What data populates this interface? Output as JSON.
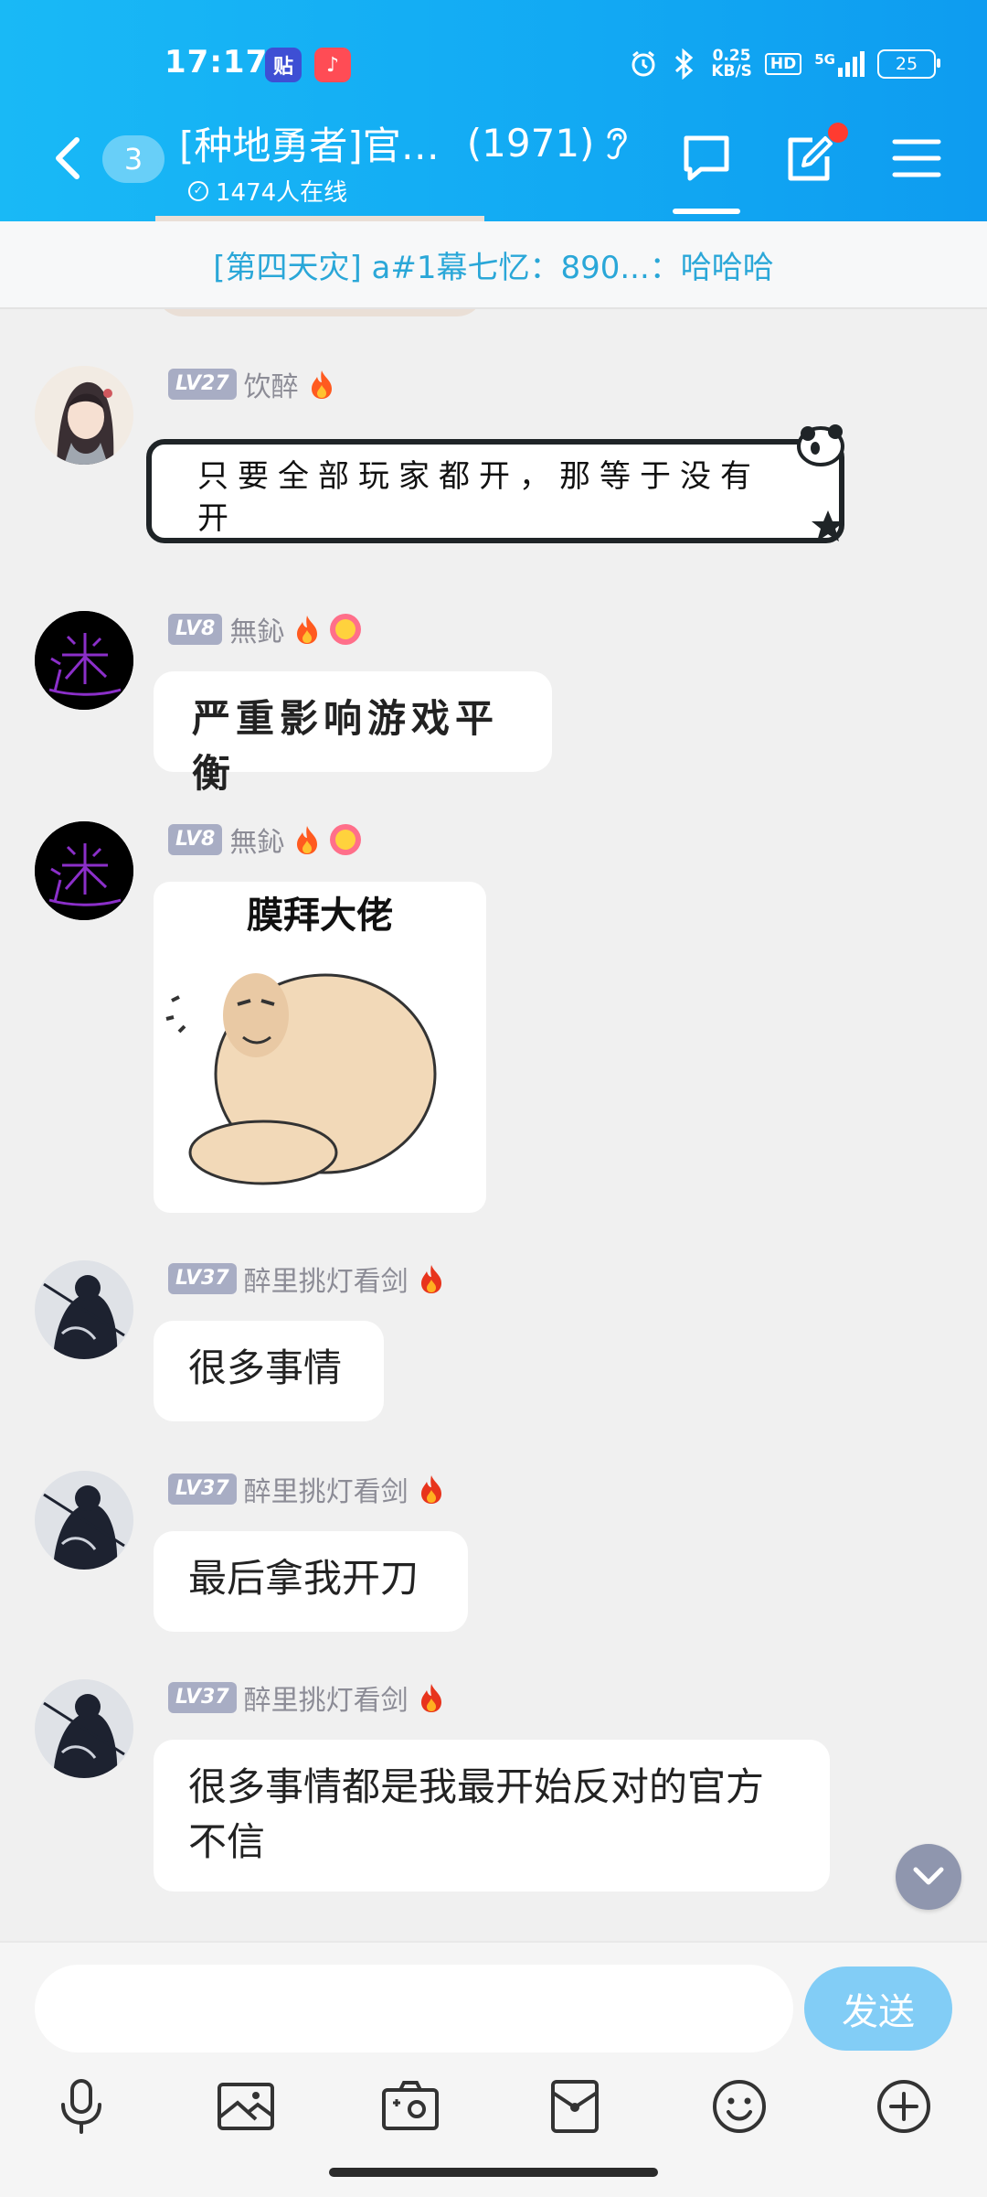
{
  "status_bar": {
    "time": "17:17",
    "app_icon_1": "贴",
    "app_icon_2": "♪",
    "net_speed_value": "0.25",
    "net_speed_unit": "KB/S",
    "hd": "HD",
    "signal": "5G",
    "battery": "25"
  },
  "header": {
    "unread_count": "3",
    "group_name": "[种地勇者]官…",
    "member_count": "(1971)",
    "online_text": "1474人在线",
    "active_tab": "chat"
  },
  "pinned": {
    "text": "[第四天灾] a#1幕七忆：890...：哈哈哈"
  },
  "messages": [
    {
      "level": "LV27",
      "name": "饮醉",
      "text": "只要全部玩家都开，那等于没有开"
    },
    {
      "level": "LV8",
      "name": "無鈊",
      "text": "严重影响游戏平衡"
    },
    {
      "level": "LV8",
      "name": "無鈊",
      "sticker_caption": "膜拜大佬"
    },
    {
      "level": "LV37",
      "name": "醉里挑灯看剑",
      "text": "很多事情"
    },
    {
      "level": "LV37",
      "name": "醉里挑灯看剑",
      "text": "最后拿我开刀"
    },
    {
      "level": "LV37",
      "name": "醉里挑灯看剑",
      "text": "很多事情都是我最开始反对的官方不信"
    }
  ],
  "input": {
    "placeholder": "",
    "send_label": "发送"
  },
  "toolbar_icons": [
    "microphone-icon",
    "image-icon",
    "camera-icon",
    "red-packet-icon",
    "emoji-icon",
    "plus-icon"
  ],
  "colors": {
    "header_bg": "#12a9f3",
    "send_button": "#82cdf6",
    "pinned_text": "#2aa7d8",
    "level_badge": "#a8adc4"
  }
}
